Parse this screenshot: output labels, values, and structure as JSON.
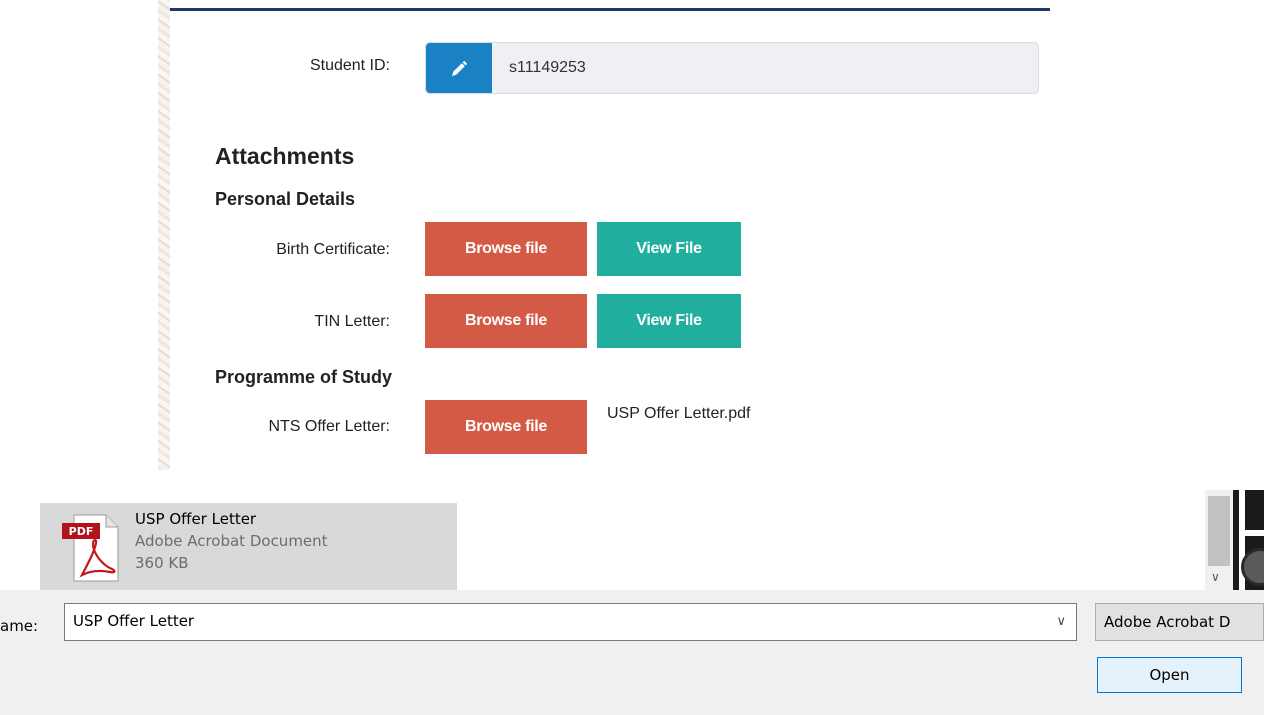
{
  "form": {
    "student_id_label": "Student ID:",
    "student_id_value": "s11149253",
    "edit_icon": "pencil-icon",
    "attachments_heading": "Attachments",
    "personal_heading": "Personal Details",
    "birth_label": "Birth Certificate:",
    "tin_label": "TIN Letter:",
    "programme_heading": "Programme of Study",
    "nts_label": "NTS Offer Letter:",
    "browse_label": "Browse file",
    "view_label": "View File",
    "chosen_file": "USP Offer Letter.pdf",
    "colors": {
      "browse": "#d35b46",
      "view": "#20ae9e",
      "edit": "#1a82c4",
      "rule": "#1f3a68"
    }
  },
  "dialog": {
    "file": {
      "icon_badge": "PDF",
      "name": "USP Offer Letter",
      "type": "Adobe Acrobat Document",
      "size": "360 KB"
    },
    "filename_label": "ame:",
    "filename_value": "USP Offer Letter",
    "filetype_value": "Adobe Acrobat D",
    "open_label": "Open"
  }
}
